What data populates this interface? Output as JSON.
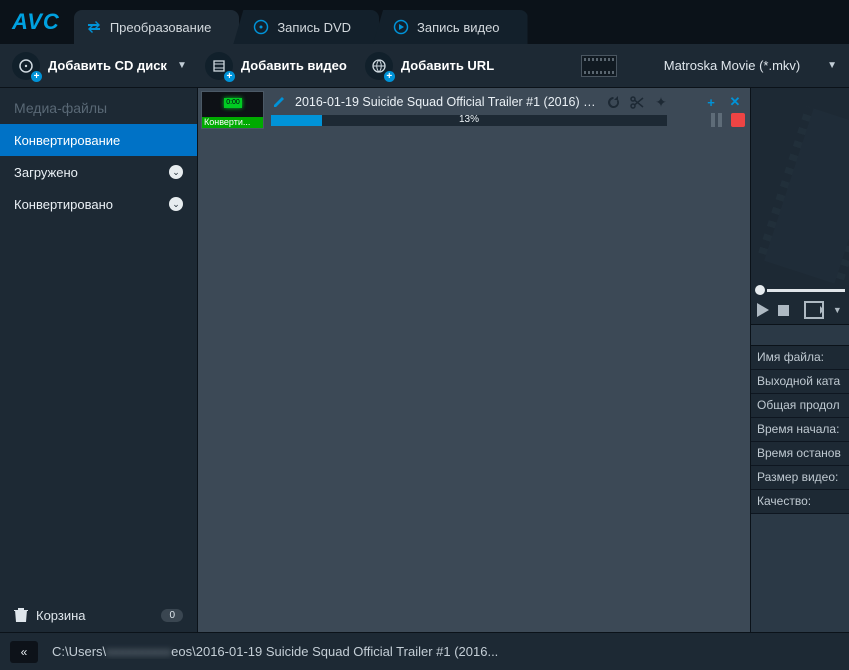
{
  "logo": "AVC",
  "tabs": [
    {
      "label": "Преобразование",
      "icon": "convert"
    },
    {
      "label": "Запись DVD",
      "icon": "disc"
    },
    {
      "label": "Запись видео",
      "icon": "play"
    }
  ],
  "toolbar": {
    "add_cd": "Добавить CD диск",
    "add_video": "Добавить видео",
    "add_url": "Добавить URL"
  },
  "format_selected": "Matroska Movie (*.mkv)",
  "sidebar": {
    "header": "Медиа-файлы",
    "items": [
      {
        "label": "Конвертирование",
        "sel": true
      },
      {
        "label": "Загружено",
        "sel": false
      },
      {
        "label": "Конвертировано",
        "sel": false
      }
    ],
    "trash_label": "Корзина",
    "trash_count": "0"
  },
  "item": {
    "title": "2016-01-19 Suicide Squad Official Trailer #1 (2016) - J...",
    "thumb_overlay": "Конверти...",
    "thumb_led": "0:00",
    "progress_pct": 13,
    "progress_label": "13%"
  },
  "right": {
    "rows": [
      "Имя файла:",
      "Выходной ката",
      "Общая продол",
      "Время начала:",
      "Время останов",
      "Размер видео:",
      "Качество:"
    ]
  },
  "bottom": {
    "back": "«",
    "path_prefix": "C:\\Users\\",
    "path_blur": "xxxxxxxxxx",
    "path_suffix": "eos\\2016-01-19 Suicide Squad Official Trailer #1 (2016..."
  }
}
